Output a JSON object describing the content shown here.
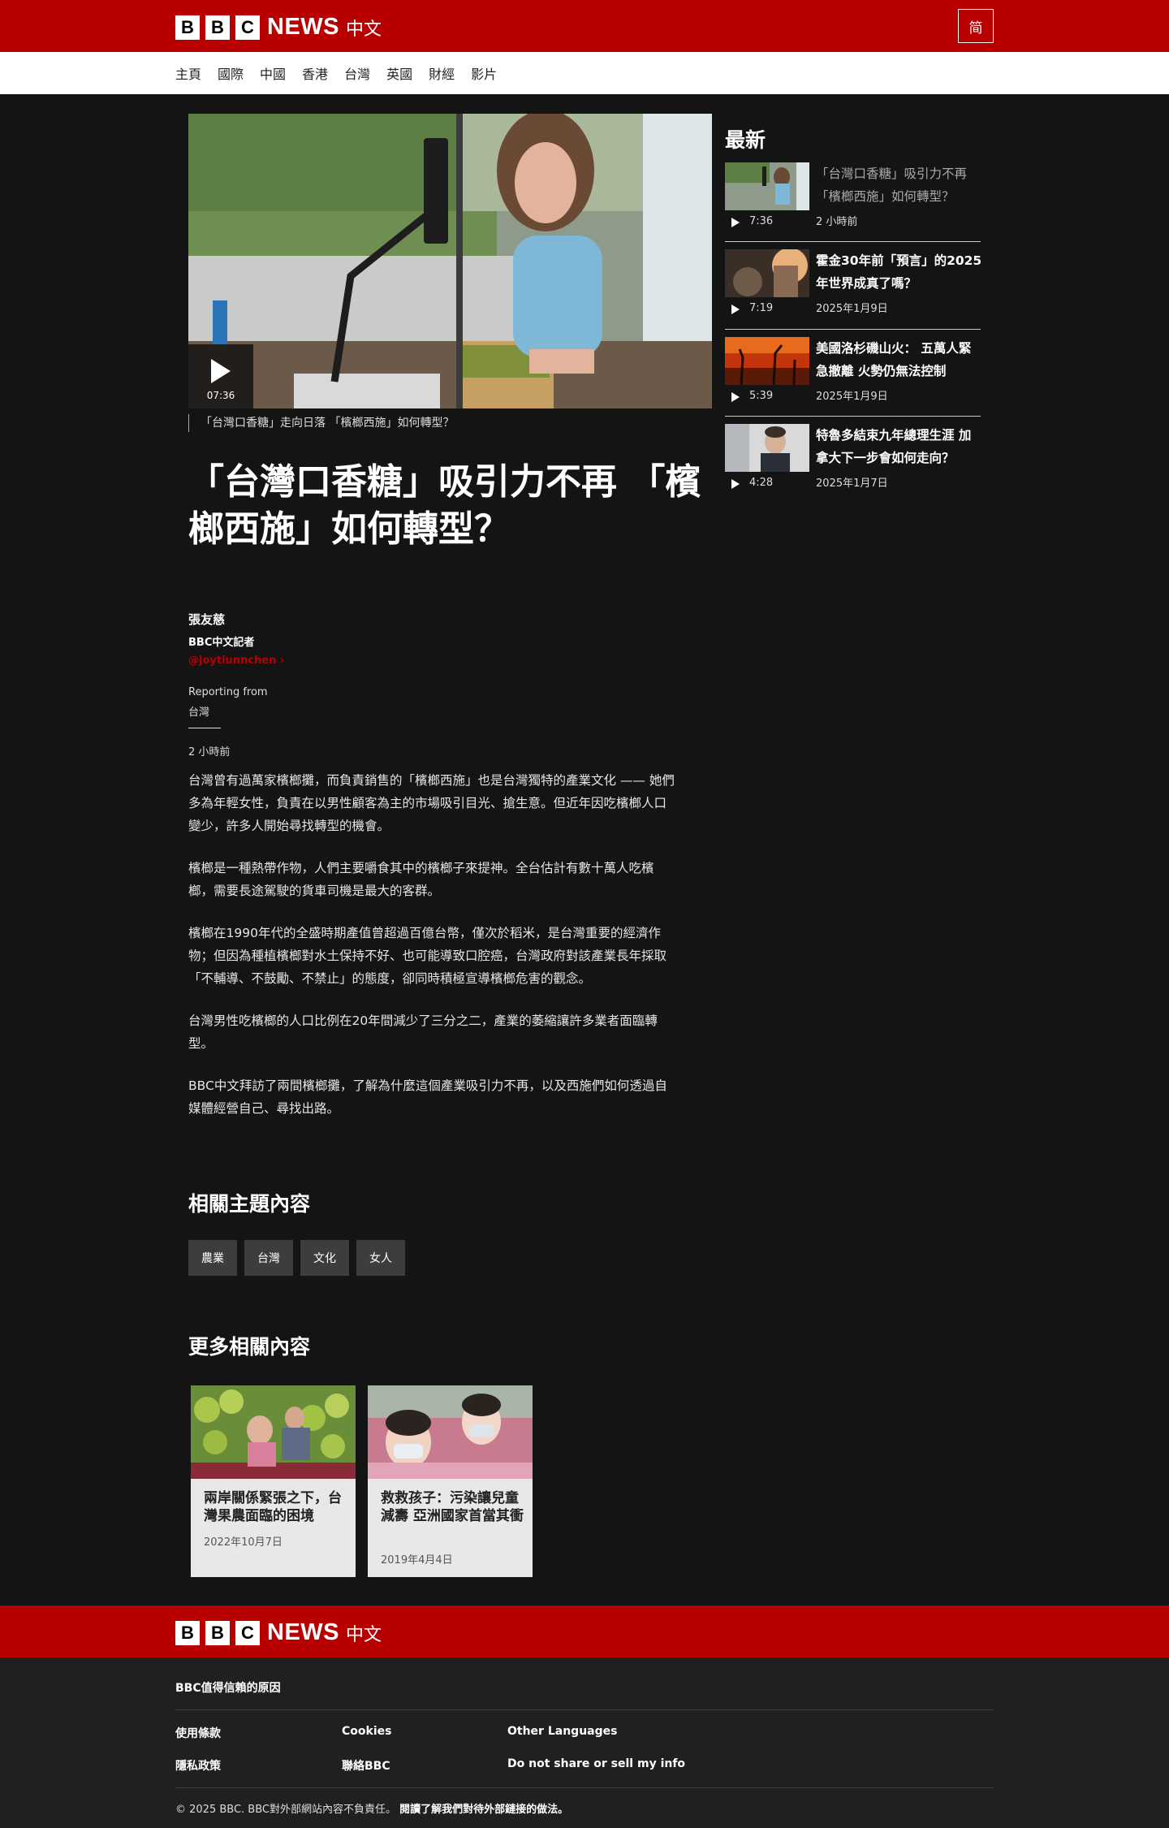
{
  "header": {
    "logo_letters": [
      "B",
      "B",
      "C"
    ],
    "logo_news": "NEWS",
    "logo_lang": "中文",
    "script_toggle": "简"
  },
  "nav": {
    "items": [
      "主頁",
      "國際",
      "中國",
      "香港",
      "台灣",
      "英國",
      "財經",
      "影片"
    ]
  },
  "video": {
    "duration": "07:36",
    "caption": "「台灣口香糖」走向日落 「檳榔西施」如何轉型？"
  },
  "article": {
    "headline": "「台灣口香糖」吸引力不再 「檳榔西施」如何轉型？",
    "author": "張友慈",
    "role": "BBC中文記者",
    "handle": "@joytiunnchen",
    "reporting_label": "Reporting from",
    "reporting_place": "台灣",
    "published": "2 小時前",
    "paragraphs": [
      "台灣曾有過萬家檳榔攤，而負責銷售的「檳榔西施」也是台灣獨特的產業文化 —— 她們多為年輕女性，負責在以男性顧客為主的市場吸引目光、搶生意。但近年因吃檳榔人口變少，許多人開始尋找轉型的機會。",
      "檳榔是一種熱帶作物，人們主要嚼食其中的檳榔子來提神。全台估計有數十萬人吃檳榔，需要長途駕駛的貨車司機是最大的客群。",
      "檳榔在1990年代的全盛時期產值曾超過百億台幣，僅次於稻米，是台灣重要的經濟作物；但因為種植檳榔對水土保持不好、也可能導致口腔癌，台灣政府對該產業長年採取「不輔導、不鼓勵、不禁止」的態度，卻同時積極宣導檳榔危害的觀念。",
      "台灣男性吃檳榔的人口比例在20年間減少了三分之二，產業的萎縮讓許多業者面臨轉型。",
      "BBC中文拜訪了兩間檳榔攤，了解為什麼這個產業吸引力不再，以及西施們如何透過自媒體經營自己、尋找出路。"
    ]
  },
  "topics": {
    "title": "相關主題內容",
    "tags": [
      "農業",
      "台灣",
      "文化",
      "女人"
    ]
  },
  "more": {
    "title": "更多相關內容",
    "cards": [
      {
        "title": "兩岸關係緊張之下，台灣果農面臨的困境",
        "date": "2022年10月7日"
      },
      {
        "title": "救救孩子：污染讓兒童減壽 亞洲國家首當其衝",
        "date": "2019年4月4日"
      }
    ]
  },
  "sidebar": {
    "title": "最新",
    "items": [
      {
        "title": "「台灣口香糖」吸引力不再 「檳榔西施」如何轉型？",
        "duration": "7:36",
        "date": "2 小時前"
      },
      {
        "title": "霍金30年前「預言」的2025年世界成真了嗎？",
        "duration": "7:19",
        "date": "2025年1月9日"
      },
      {
        "title": "美國洛杉磯山火： 五萬人緊急撤離 火勢仍無法控制",
        "duration": "5:39",
        "date": "2025年1月9日"
      },
      {
        "title": "特魯多結束九年總理生涯 加拿大下一步會如何走向？",
        "duration": "4:28",
        "date": "2025年1月7日"
      }
    ]
  },
  "footer": {
    "why_trust": "BBC值得信賴的原因",
    "links": [
      "使用條款",
      "Cookies",
      "Other Languages",
      "隱私政策",
      "聯絡BBC",
      "Do not share or sell my info"
    ],
    "copyright": "© 2025 BBC. BBC對外部網站內容不負責任。",
    "external_policy": "閱讀了解我們對待外部鏈接的做法。"
  }
}
